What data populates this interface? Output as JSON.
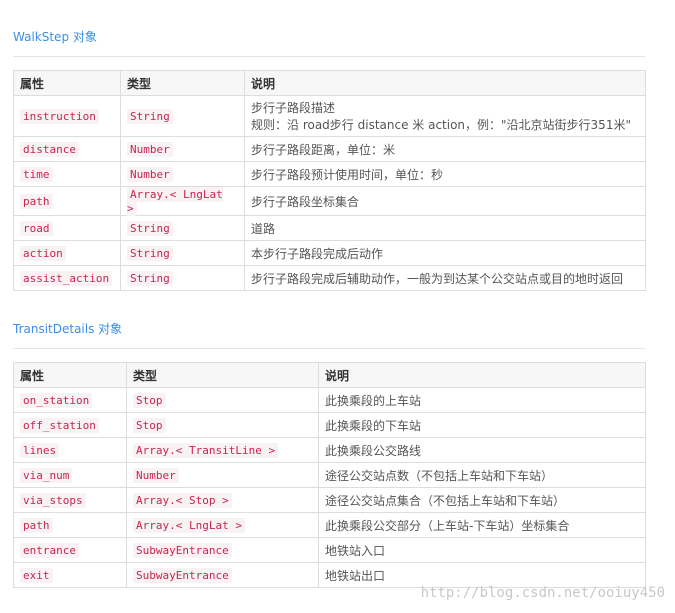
{
  "walkstep": {
    "title": "WalkStep 对象",
    "headers": [
      "属性",
      "类型",
      "说明"
    ],
    "rows": [
      {
        "attr": "instruction",
        "type": "String",
        "desc": "步行子路段描述",
        "desc2": "规则：沿 road步行 distance 米 action，例：\"沿北京站街步行351米\""
      },
      {
        "attr": "distance",
        "type": "Number",
        "desc": "步行子路段距离，单位：米"
      },
      {
        "attr": "time",
        "type": "Number",
        "desc": "步行子路段预计使用时间，单位：秒"
      },
      {
        "attr": "path",
        "type": "Array.< LngLat >",
        "desc": "步行子路段坐标集合"
      },
      {
        "attr": "road",
        "type": "String",
        "desc": "道路"
      },
      {
        "attr": "action",
        "type": "String",
        "desc": "本步行子路段完成后动作"
      },
      {
        "attr": "assist_action",
        "type": "String",
        "desc": "步行子路段完成后辅助动作，一般为到达某个公交站点或目的地时返回"
      }
    ]
  },
  "transitdetails": {
    "title": "TransitDetails 对象",
    "headers": [
      "属性",
      "类型",
      "说明"
    ],
    "rows": [
      {
        "attr": "on_station",
        "type": "Stop",
        "desc": "此换乘段的上车站"
      },
      {
        "attr": "off_station",
        "type": "Stop",
        "desc": "此换乘段的下车站"
      },
      {
        "attr": "lines",
        "type": "Array.< TransitLine >",
        "desc": "此换乘段公交路线"
      },
      {
        "attr": "via_num",
        "type": "Number",
        "desc": "途径公交站点数（不包括上车站和下车站）"
      },
      {
        "attr": "via_stops",
        "type": "Array.< Stop >",
        "desc": "途径公交站点集合（不包括上车站和下车站）"
      },
      {
        "attr": "path",
        "type": "Array.< LngLat >",
        "desc": "此换乘段公交部分（上车站-下车站）坐标集合"
      },
      {
        "attr": "entrance",
        "type": "SubwayEntrance",
        "desc": "地铁站入口"
      },
      {
        "attr": "exit",
        "type": "SubwayEntrance",
        "desc": "地铁站出口"
      }
    ]
  },
  "watermark": "http://blog.csdn.net/ooiuy450"
}
